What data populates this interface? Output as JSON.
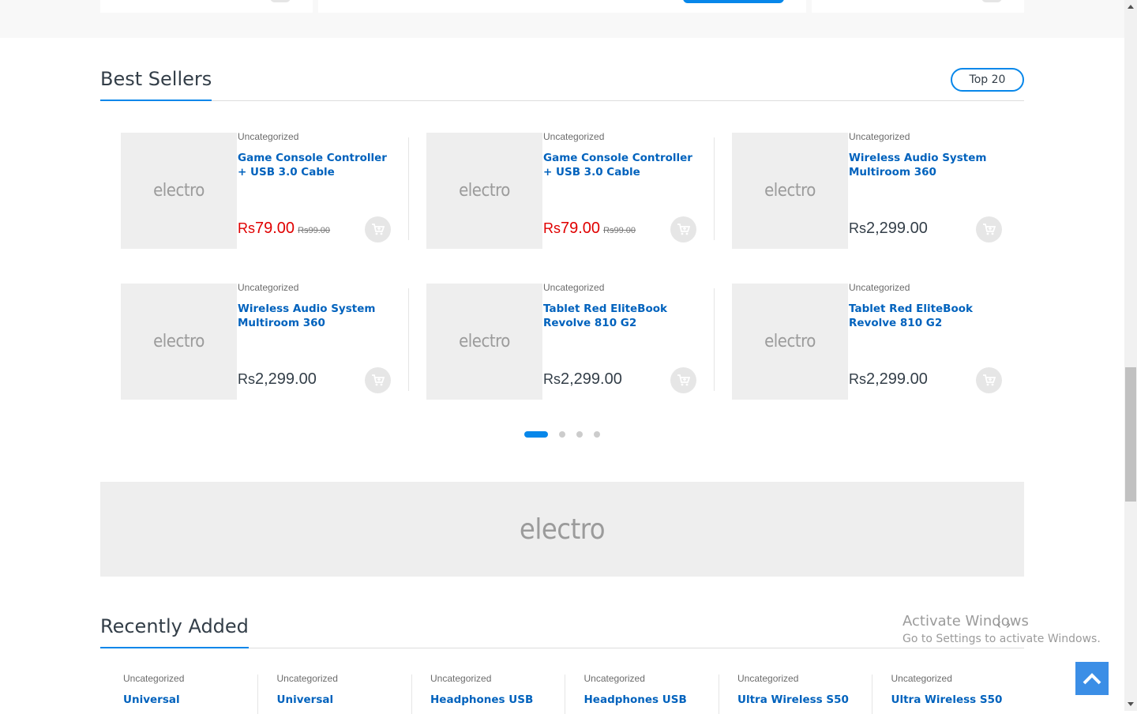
{
  "best_sellers": {
    "title": "Best Sellers",
    "tab_label": "Top 20",
    "products": [
      {
        "category": "Uncategorized",
        "title": "Game Console Controller + USB 3.0 Cable",
        "currency": "Rs",
        "price": "79.00",
        "old_currency": "Rs",
        "old_price": "99.00",
        "on_sale": true,
        "image_label": "electro"
      },
      {
        "category": "Uncategorized",
        "title": "Game Console Controller + USB 3.0 Cable",
        "currency": "Rs",
        "price": "79.00",
        "old_currency": "Rs",
        "old_price": "99.00",
        "on_sale": true,
        "image_label": "electro"
      },
      {
        "category": "Uncategorized",
        "title": "Wireless Audio System Multiroom 360",
        "currency": "Rs",
        "price": "2,299.00",
        "on_sale": false,
        "image_label": "electro"
      },
      {
        "category": "Uncategorized",
        "title": "Wireless Audio System Multiroom 360",
        "currency": "Rs",
        "price": "2,299.00",
        "on_sale": false,
        "image_label": "electro"
      },
      {
        "category": "Uncategorized",
        "title": "Tablet Red EliteBook Revolve 810 G2",
        "currency": "Rs",
        "price": "2,299.00",
        "on_sale": false,
        "image_label": "electro"
      },
      {
        "category": "Uncategorized",
        "title": "Tablet Red EliteBook Revolve 810 G2",
        "currency": "Rs",
        "price": "2,299.00",
        "on_sale": false,
        "image_label": "electro"
      }
    ],
    "carousel": {
      "pages": 4,
      "active_page": 1
    }
  },
  "banner": {
    "image_label": "electro"
  },
  "recently_added": {
    "title": "Recently Added",
    "products": [
      {
        "category": "Uncategorized",
        "title": "Universal"
      },
      {
        "category": "Uncategorized",
        "title": "Universal"
      },
      {
        "category": "Uncategorized",
        "title": "Headphones USB"
      },
      {
        "category": "Uncategorized",
        "title": "Headphones USB"
      },
      {
        "category": "Uncategorized",
        "title": "Ultra Wireless S50"
      },
      {
        "category": "Uncategorized",
        "title": "Ultra Wireless S50"
      }
    ]
  },
  "watermark": {
    "line1": "Activate Windows",
    "line2": "Go to Settings to activate Windows."
  },
  "icons": {
    "cart": "add-to-cart-icon",
    "back_to_top": "chevron-up-icon",
    "prev": "chevron-left-icon",
    "next": "chevron-right-icon"
  },
  "colors": {
    "accent": "#0787ea",
    "sale_price": "#e00000",
    "link": "#0062bd"
  }
}
